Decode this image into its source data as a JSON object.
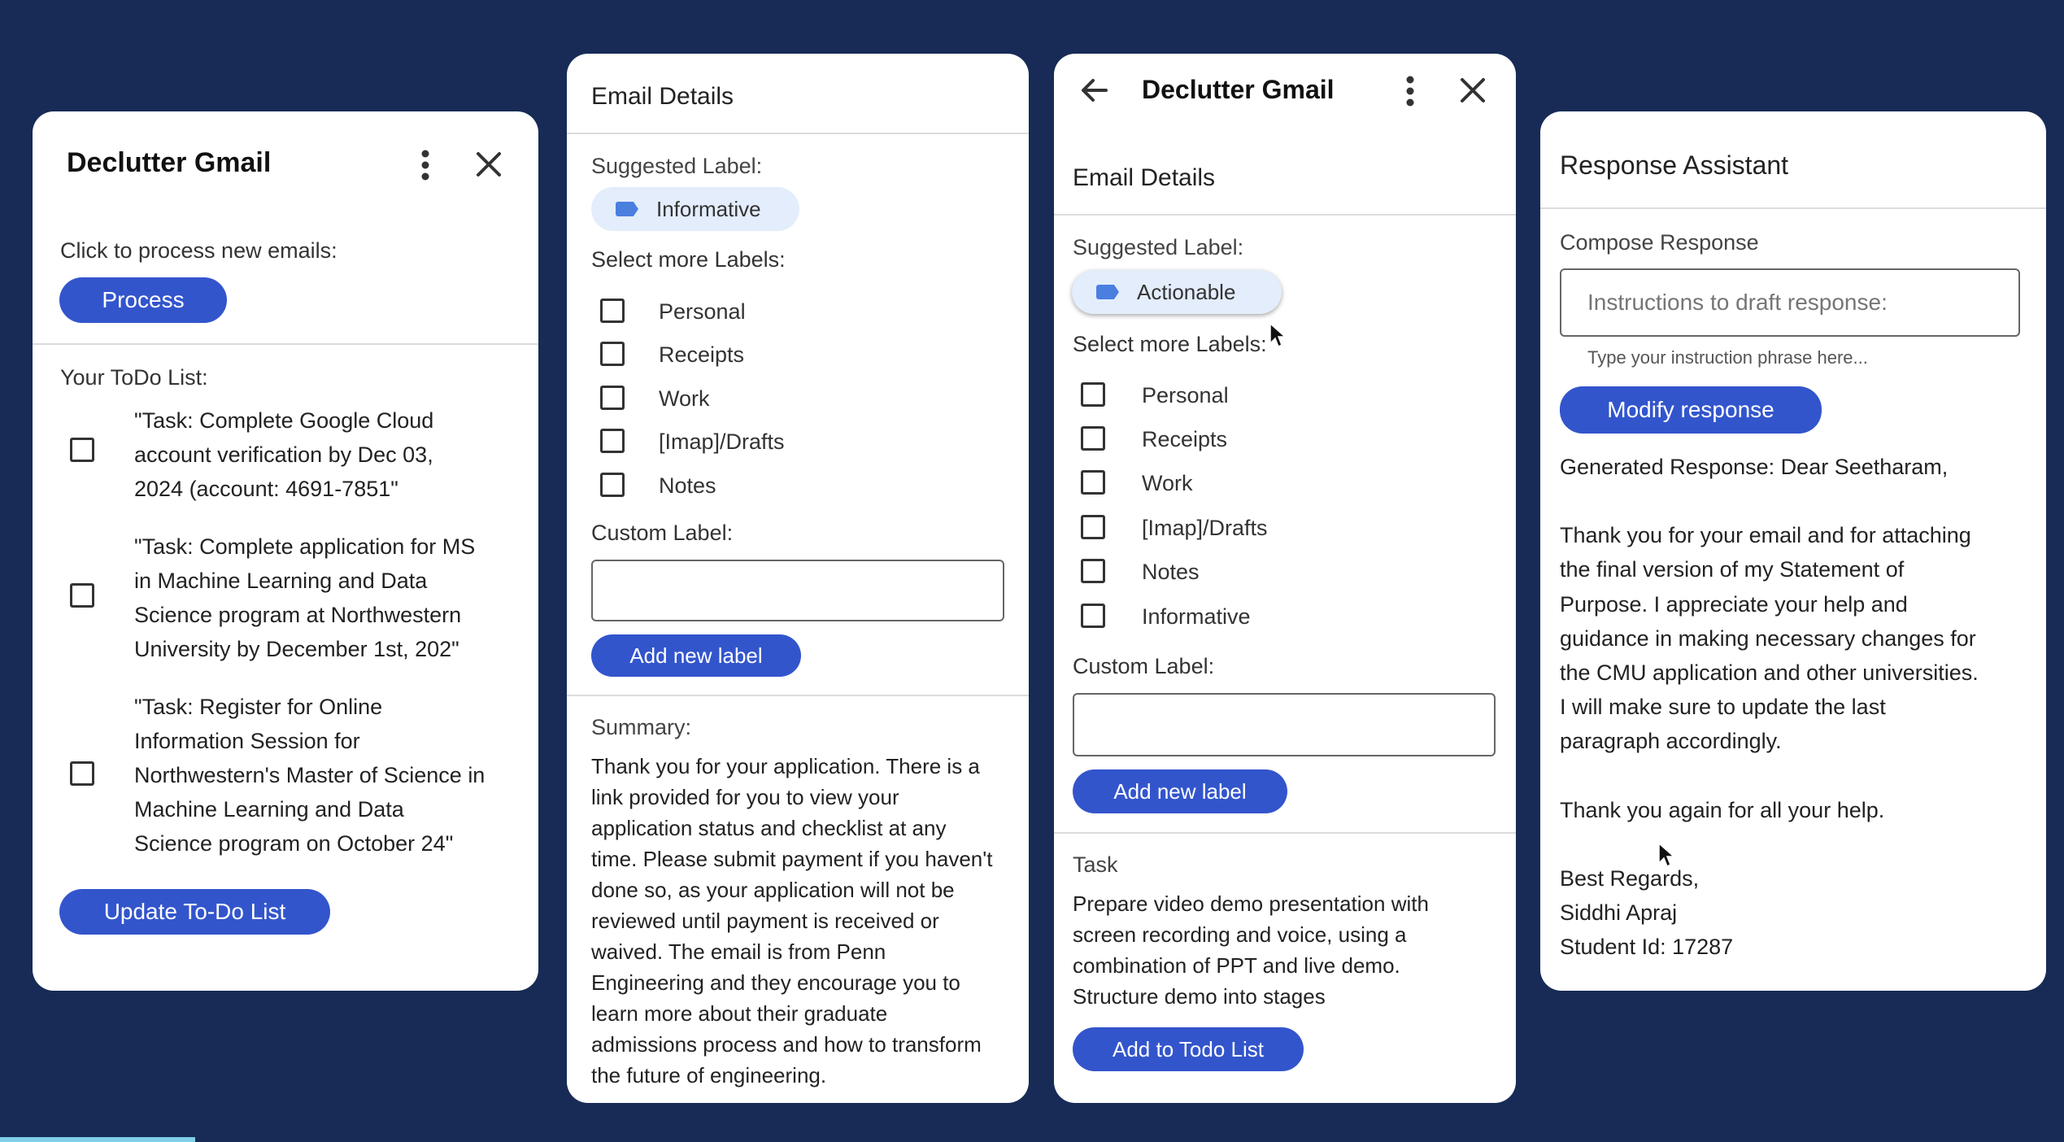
{
  "panel1": {
    "title": "Declutter Gmail",
    "process_prompt": "Click to process new emails:",
    "process_button": "Process",
    "todo_heading": "Your ToDo List:",
    "todos": [
      {
        "line1": "\"Task: Complete Google Cloud",
        "line2": "account verification by Dec 03,",
        "line3": "2024 (account: 4691-7851\""
      },
      {
        "line1": "\"Task: Complete application for MS",
        "line2": "in Machine Learning and Data",
        "line3": "Science program at Northwestern",
        "line4": "University by December 1st, 202\""
      },
      {
        "line1": "\"Task: Register for Online",
        "line2": "Information Session for",
        "line3": "Northwestern's Master of Science in",
        "line4": "Machine Learning and Data",
        "line5": "Science program on October 24\""
      }
    ],
    "update_button": "Update To-Do List"
  },
  "panel2": {
    "title": "Email Details",
    "suggested_label_heading": "Suggested Label:",
    "suggested_label": "Informative",
    "select_more_heading": "Select more Labels:",
    "labels": [
      "Personal",
      "Receipts",
      "Work",
      "[Imap]/Drafts",
      "Notes"
    ],
    "custom_label_heading": "Custom Label:",
    "custom_label_value": "",
    "add_label_button": "Add new label",
    "summary_heading": "Summary:",
    "summary_lines": [
      "Thank you for your application. There is a",
      "link provided for you to view your",
      "application status and checklist at any",
      "time. Please submit payment if you haven't",
      "done so, as your application will not be",
      "reviewed until payment is received or",
      "waived. The email is from Penn",
      "Engineering and they encourage you to",
      "learn more about their graduate",
      "admissions process and how to transform",
      "the future of engineering."
    ]
  },
  "panel3": {
    "title": "Declutter Gmail",
    "subtitle": "Email Details",
    "suggested_label_heading": "Suggested Label:",
    "suggested_label": "Actionable",
    "select_more_heading": "Select more Labels:",
    "labels": [
      "Personal",
      "Receipts",
      "Work",
      "[Imap]/Drafts",
      "Notes",
      "Informative"
    ],
    "custom_label_heading": "Custom Label:",
    "custom_label_value": "",
    "add_label_button": "Add new label",
    "task_heading": "Task",
    "task_lines": [
      "Prepare video demo presentation with",
      "screen recording and voice, using a",
      "combination of PPT and live demo.",
      "Structure demo into stages"
    ],
    "add_todo_button": "Add to Todo List"
  },
  "panel4": {
    "title": "Response Assistant",
    "compose_heading": "Compose Response",
    "instruction_placeholder": "Instructions to draft response:",
    "instruction_hint": "Type your instruction phrase here...",
    "modify_button": "Modify response",
    "response_lines": [
      "Generated Response: Dear Seetharam,",
      "",
      "Thank you for your email and for attaching",
      "the final version of my Statement of",
      "Purpose. I appreciate your help and",
      "guidance in making necessary changes for",
      "the CMU application and other universities.",
      "I will make sure to update the last",
      "paragraph accordingly.",
      "",
      "Thank you again for all your help.",
      "",
      "Best Regards,",
      "Siddhi Apraj",
      "Student Id: 17287"
    ]
  },
  "icons": {
    "more": "more-vert-icon",
    "close": "close-icon",
    "back": "arrow-back-icon",
    "label": "label-tag-icon",
    "cursor": "mouse-cursor-icon"
  },
  "colors": {
    "background": "#172b56",
    "accent": "#3355cc",
    "chip": "#e3edfb",
    "panel": "#ffffff"
  }
}
